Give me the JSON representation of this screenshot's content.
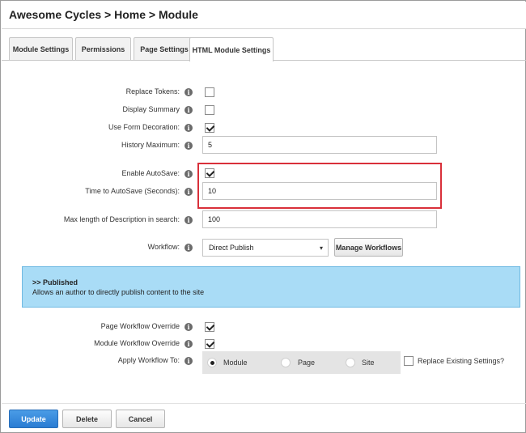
{
  "breadcrumb": "Awesome Cycles > Home > Module",
  "tabs": [
    "Module Settings",
    "Permissions",
    "Page Settings",
    "HTML Module Settings"
  ],
  "info_glyph": "i",
  "fields": {
    "replace_tokens": {
      "label": "Replace Tokens:",
      "checked": false
    },
    "display_summary": {
      "label": "Display Summary",
      "checked": false
    },
    "use_form_decoration": {
      "label": "Use Form Decoration:",
      "checked": true
    },
    "history_maximum": {
      "label": "History Maximum:",
      "value": "5"
    },
    "enable_autosave": {
      "label": "Enable AutoSave:",
      "checked": true
    },
    "time_to_autosave": {
      "label": "Time to AutoSave (Seconds):",
      "value": "10"
    },
    "max_length_description": {
      "label": "Max length of Description in search:",
      "value": "100"
    },
    "workflow": {
      "label": "Workflow:",
      "value": "Direct Publish",
      "button": "Manage Workflows"
    }
  },
  "workflow_panel": {
    "heading": ">> Published",
    "description": "Allows an author to directly publish content to the site"
  },
  "overrides": {
    "page_workflow_override": {
      "label": "Page Workflow Override",
      "checked": true
    },
    "module_workflow_override": {
      "label": "Module Workflow Override",
      "checked": true
    },
    "apply_workflow_to": {
      "label": "Apply Workflow To:",
      "options": [
        "Module",
        "Page",
        "Site"
      ],
      "selected": "Module"
    },
    "replace_existing": {
      "label": "Replace Existing Settings?",
      "checked": false
    }
  },
  "actions": {
    "update": "Update",
    "delete": "Delete",
    "cancel": "Cancel"
  },
  "colors": {
    "primary_button": "#2a7cd3",
    "panel_bg": "#a9dcf6",
    "highlight": "#d9303a"
  }
}
